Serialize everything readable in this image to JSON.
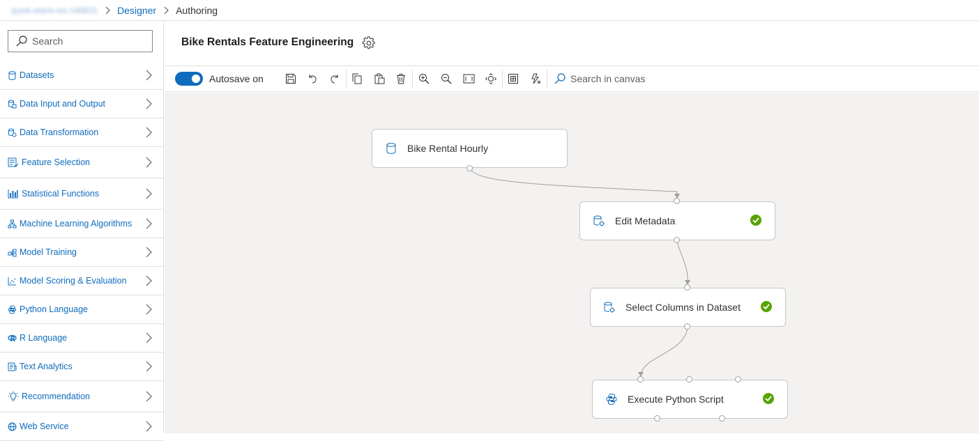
{
  "breadcrumb": {
    "workspace": "quick-starts-ws-148831",
    "designer": "Designer",
    "current": "Authoring"
  },
  "sidebar": {
    "search_placeholder": "Search",
    "categories": [
      {
        "label": "Datasets",
        "icon": "database-icon"
      },
      {
        "label": "Data Input and Output",
        "icon": "data-io-icon"
      },
      {
        "label": "Data Transformation",
        "icon": "data-transform-icon"
      },
      {
        "label": "Feature Selection",
        "icon": "feature-selection-icon"
      },
      {
        "label": "Statistical Functions",
        "icon": "bar-chart-icon"
      },
      {
        "label": "Machine Learning Algorithms",
        "icon": "hierarchy-icon"
      },
      {
        "label": "Model Training",
        "icon": "model-training-icon"
      },
      {
        "label": "Model Scoring & Evaluation",
        "icon": "scatter-chart-icon"
      },
      {
        "label": "Python Language",
        "icon": "python-icon"
      },
      {
        "label": "R Language",
        "icon": "r-language-icon"
      },
      {
        "label": "Text Analytics",
        "icon": "text-document-icon"
      },
      {
        "label": "Recommendation",
        "icon": "lightbulb-icon"
      },
      {
        "label": "Web Service",
        "icon": "globe-icon"
      }
    ]
  },
  "header": {
    "title": "Bike Rentals Feature Engineering"
  },
  "toolbar": {
    "autosave_label": "Autosave on",
    "autosave_on": true,
    "canvas_search_placeholder": "Search in canvas",
    "buttons": [
      "save-icon",
      "undo-icon",
      "redo-icon",
      "copy-icon",
      "paste-icon",
      "delete-icon",
      "zoom-in-icon",
      "zoom-out-icon",
      "fit-screen-icon",
      "pan-icon",
      "grid-icon",
      "auto-layout-icon"
    ]
  },
  "pipeline": {
    "nodes": [
      {
        "label": "Bike Rental Hourly",
        "icon": "database-icon",
        "completed": false
      },
      {
        "label": "Edit Metadata",
        "icon": "data-transform-icon",
        "completed": true
      },
      {
        "label": "Select Columns in Dataset",
        "icon": "data-transform-icon",
        "completed": true
      },
      {
        "label": "Execute Python Script",
        "icon": "python-icon",
        "completed": true
      }
    ]
  },
  "colors": {
    "accent": "#0f6cbd",
    "success": "#57a300",
    "canvas_bg": "#f3f2f1"
  }
}
